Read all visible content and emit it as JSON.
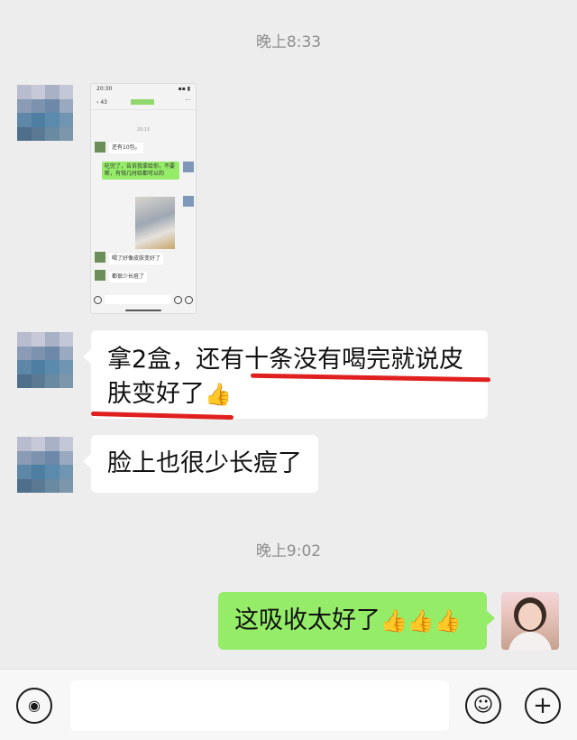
{
  "chat": {
    "timestamps": [
      "晚上8:33",
      "晚上9:02"
    ],
    "messages": [
      {
        "type": "image",
        "sender": "contact",
        "description": "screenshot"
      },
      {
        "type": "text",
        "sender": "contact",
        "line1": "拿2盒，还有十条没有喝完就说皮",
        "line2": "肤变好了",
        "emoji": "👍"
      },
      {
        "type": "text",
        "sender": "contact",
        "text": "脸上也很少长痘了"
      },
      {
        "type": "text",
        "sender": "me",
        "text": "这吸收太好了",
        "emoji": "👍👍👍"
      }
    ]
  },
  "screenshot_thumb": {
    "status_time": "20:30",
    "back_count": "43",
    "timestamp": "20:15",
    "msg1": "还有10包。",
    "msg2": "吃完了，告诉我拿给你，不要断，有钱几时给都可以的",
    "msg3": "喝了好像皮肤变好了",
    "msg4": "都很少长痘了"
  },
  "input_bar": {
    "voice_icon": "voice-icon",
    "emoji_icon": "emoji-icon",
    "plus_icon": "plus-icon"
  },
  "colors": {
    "background": "#ededed",
    "sent_bubble": "#95ec69",
    "received_bubble": "#ffffff",
    "highlight_underline": "#e0201f"
  }
}
